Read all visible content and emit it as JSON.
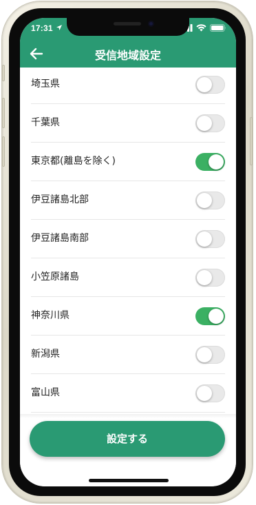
{
  "status_bar": {
    "time": "17:31"
  },
  "header": {
    "title": "受信地域設定",
    "back_icon": "arrow-left-icon"
  },
  "regions": [
    {
      "label": "埼玉県",
      "enabled": false
    },
    {
      "label": "千葉県",
      "enabled": false
    },
    {
      "label": "東京都(離島を除く)",
      "enabled": true
    },
    {
      "label": "伊豆諸島北部",
      "enabled": false
    },
    {
      "label": "伊豆諸島南部",
      "enabled": false
    },
    {
      "label": "小笠原諸島",
      "enabled": false
    },
    {
      "label": "神奈川県",
      "enabled": true
    },
    {
      "label": "新潟県",
      "enabled": false
    },
    {
      "label": "富山県",
      "enabled": false
    }
  ],
  "footer": {
    "save_label": "設定する"
  },
  "colors": {
    "brand_green": "#2a9a73",
    "toggle_on": "#3bb063",
    "toggle_off": "#e9e9e9"
  }
}
